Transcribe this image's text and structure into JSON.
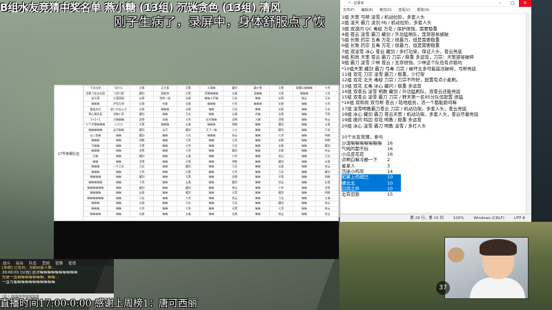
{
  "overlay": {
    "top_text": "B组水友竞猜中奖名单  燕小糖 (13组)  沉迷贪色 (13组)  清风",
    "sub_text": "刚子生病了，录屏中，身体舒服点了恢",
    "ticker": "直播时间17:00-0:00  感谢上周榜1：唐可西丽"
  },
  "sheet": {
    "title": "17号参赛队伍",
    "rows": [
      [
        "下次出发",
        "没什么",
        "天策",
        "无主意",
        "天策",
        "沙漠嘛",
        "藏剑",
        "飘小雪",
        "天策",
        "醉醺么嘛嘛嘛",
        "七秀"
      ],
      [
        "凌霄飞花自在醉",
        "飞凌月影",
        "藏剑",
        "夏乾坤",
        "天策",
        "凌霄嘛嘛嘛",
        "五毒",
        "凌嘛嘛",
        "天策",
        "嘛嘛嘛",
        "七秀"
      ],
      [
        "安乐窝",
        "大漠孤烟",
        "长歌",
        "悠哉一族",
        "长歌",
        "嘛嘛小乔嘛",
        "万花",
        "嘛嘛",
        "长歌",
        "微云",
        "万花"
      ],
      [
        "嘛嘛嘛",
        "护驾左侧",
        "长歌",
        "布鲁",
        "长歌",
        "嘛嘛嘛",
        "七秀",
        "嘛嘛嘛",
        "长歌",
        "嘛嘛",
        "七秀"
      ],
      [
        "霸道夫妇",
        "超人刘长山子",
        "长歌",
        "嘛嘛嘛",
        "长歌",
        "嘛嘛",
        "万花",
        "嘛嘛",
        "长歌",
        "嘛嘛",
        "万花"
      ],
      [
        "寒心赠别某",
        "凌嘛小萌",
        "藏剑",
        "嘛嘛",
        "万花",
        "嘛嘛",
        "五毒",
        "花嘛",
        "长歌",
        "嘛嘛",
        "丐帮"
      ],
      [
        "2+2+1",
        "大嘛嘛嘛",
        "凌雪",
        "朵嘛",
        "七秀",
        "花木嘛嘛",
        "凌雪",
        "大嘛",
        "凌雪",
        "嘛嘛",
        "苍云"
      ],
      [
        "七个步骤嘛嘛嘛",
        "小刀刀",
        "天策",
        "嘛嘛嘛",
        "五毒",
        "嘛嘛嘛",
        "明教",
        "嘛嘛",
        "藏剑",
        "嘛嘛",
        "五毒"
      ],
      [
        "嘛嘛嘛嘛嘛",
        "云可嘛嘛",
        "藏剑",
        "云尽",
        "藏剑",
        "天下一嘛",
        "小刀",
        "嘛嘛",
        "藏剑",
        "嘛嘛",
        "万花"
      ],
      [
        "去二首嘛",
        "嘛嘛",
        "藏剑",
        "嘛嘛",
        "万花",
        "嘛嘛嘛",
        "苍云",
        "嘛嘛",
        "七秀",
        "嘛嘛",
        "明教"
      ],
      [
        "嘛嘛嘛",
        "嘛嘛",
        "明教",
        "嘛嘛",
        "七秀",
        "嘛嘛",
        "七秀",
        "嘛嘛",
        "长歌",
        "嘛嘛",
        "明教"
      ],
      [
        "打嘛嘛",
        "嘛嘛",
        "天策",
        "嘛嘛",
        "七秀",
        "嘛嘛",
        "万花",
        "嘛嘛",
        "长歌",
        "嘛嘛",
        "藏剑"
      ],
      [
        "嘛嘛嘛",
        "嘛嘛",
        "凌雪",
        "嘛嘛",
        "七秀",
        "嘛嘛",
        "藏剑",
        "嘛嘛",
        "长歌",
        "嘛嘛",
        "苍云"
      ],
      [
        "打嘛",
        "嘛嘛",
        "藏剑",
        "嘛嘛",
        "五毒",
        "嘛嘛",
        "七秀",
        "嘛嘛",
        "苍云",
        "嘛嘛",
        "万花"
      ],
      [
        "嘛嘛",
        "嘛嘛",
        "凌雪",
        "嘛嘛",
        "天策",
        "嘛嘛",
        "明教",
        "嘛嘛",
        "藏剑",
        "嘛嘛",
        "长歌"
      ],
      [
        "嘛嘛嘛",
        "一才之玄",
        "万花",
        "嘛嘛",
        "藏剑",
        "嘛嘛",
        "万花",
        "嘛嘛",
        "长歌",
        "嘛嘛",
        "苍云"
      ],
      [
        "嘛嘛嘛",
        "嘛嘛",
        "七秀",
        "嘛嘛",
        "天策",
        "嘛嘛",
        "七秀",
        "嘛嘛",
        "万花",
        "嘛嘛",
        "藏剑"
      ],
      [
        "嘛嘛嘛嘛",
        "嘛嘛",
        "藏剑",
        "嘛嘛",
        "天策",
        "嘛嘛",
        "凌雪",
        "嘛嘛",
        "天策",
        "嘛嘛",
        "明教"
      ],
      [
        "嘛嘛嘛嘛嘛",
        "嘛嘛",
        "七秀",
        "嘛嘛",
        "五毒",
        "嘛嘛",
        "藏剑",
        "嘛嘛",
        "苍云",
        "嘛嘛",
        "长歌"
      ],
      [
        "嘛嘛嘛嘛嘛嘛",
        "嘛嘛",
        "藏剑",
        "嘛嘛",
        "藏剑",
        "嘛嘛",
        "苍云",
        "嘛嘛",
        "七秀",
        "嘛嘛",
        "凌雪"
      ],
      [
        "嘛嘛嘛嘛",
        "嘛嘛",
        "长歌",
        "嘛嘛",
        "藏剑",
        "嘛嘛",
        "天策",
        "嘛嘛",
        "藏剑",
        "嘛嘛",
        "明教"
      ],
      [
        "嘛嘛嘛嘛嘛嘛",
        "嘛嘛",
        "万花",
        "嘛嘛",
        "七秀",
        "嘛嘛",
        "苍云",
        "嘛嘛",
        "万花",
        "嘛嘛",
        "五毒"
      ],
      [
        "嘛嘛嘛",
        "嘛嘛",
        "长歌",
        "嘛嘛",
        "万花",
        "嘛嘛",
        "万花",
        "嘛嘛",
        "藏剑",
        "嘛嘛",
        "苍云"
      ],
      [
        "嘛嘛嘛",
        "嘛嘛",
        "七秀",
        "嘛嘛",
        "七秀",
        "嘛嘛",
        "天策",
        "嘛嘛",
        "七秀",
        "嘛嘛",
        "苍云"
      ],
      [
        "嘛嘛嘛嘛",
        "嘛嘛",
        "长歌",
        "嘛嘛",
        "五毒",
        "嘛嘛",
        "长歌",
        "嘛嘛",
        "苍云",
        "嘛嘛",
        "苍云"
      ]
    ]
  },
  "notepad": {
    "title": "* - 记事本",
    "menu": [
      "文件(F)",
      "编辑(E)",
      "格式(O)",
      "查看(V)",
      "帮助(H)"
    ],
    "close_glyph": "✕",
    "lines": [
      "1组 天策 丐帮 凌雪 / 机动拉阶，多套人头",
      "2组 凌天 霸刀 凌剑 MJ / 机动拉阶，多套人头",
      "3组 双漠问 QC 毒经 万花 / 保护很强，需要稳重",
      "4组 苍云 凌雪 霸刀 藏剑 / 外功猛刷队，莲菜容易被破",
      "5组 长歌 药宗 五毒 万花 / 很暴力，但是需要稳重",
      "6组 长歌 药宗 五毒 万花 / 很暴力，但是需要稳重",
      "7组 双凌雪 冰心 苍云 藏剑 / 多打功架，保证人头，苍云亮底",
      "8组 和尚 天策 苍云 霸刀 刀宗 / 稳重 多运营，刀宗：天策容易破碎",
      "9组 霸刀 凌雪 少林 苍云 / 生存很强，少林这个队伍有点稳坑",
      "*10组天策 藏剑 霸刀 弓毒 刀宗 / 破坏太多可能崩况破碎，弓帮亮底",
      "11组 双花 刀宗 凌雪 霸刀 / 稳重，少打架",
      "12组 双花 北天 毒经 刀宗 / 刀宗不咋好，配置有点小麦刷。",
      "13组 双花 五毒 冰心 藏问 / 稳重 多运营",
      "14组 双苍云 凌雪 明教 藏剑 / 外功猛刷队，双苍云还能亮底",
      "15组 双苍云 凌雪 霸刀 刀宗 / 野天第一名95分队伍配置 很猛",
      "*16组 双和尚 双弓帮 苍云 / 陆地组员，活一个都能跑鸡嘛",
      "17组 凌雪明教霸刀苍云 刀宗 / 机动功架，多套人头，苍云亮底",
      "18组 冰心 藏剑 霸刀 苍云天策 / 机动功架，多套人头，苍云尽量亮底",
      "19组 唐问 鸣囚 双花 明教 / 稳重 多运营",
      "20组 冰心 凌雪 霸刀 明教 凌雪 / 多打人头"
    ],
    "ranking_title": "10个水友竞猜，参与",
    "ranking": [
      {
        "name": "沙漠嘛嘛嘛嘛嘛嘛嘛",
        "score": "16",
        "selected": false
      },
      {
        "name": "气纯的都不玩",
        "score": "16",
        "selected": false
      },
      {
        "name": "小瓜皮花花",
        "score": "16",
        "selected": false
      },
      {
        "name": "点啊白嘛冷静一下",
        "score": "2",
        "selected": false
      },
      {
        "name": "雀某人",
        "score": "3",
        "selected": false
      },
      {
        "name": "沉迷小鸡罕",
        "score": "14",
        "selected": false
      },
      {
        "name": "如果上的胡巳",
        "score": "10",
        "selected": true
      },
      {
        "name": "螺北北",
        "score": "10",
        "selected": true
      },
      {
        "name": "白鸽之声",
        "score": "10",
        "selected": true
      },
      {
        "name": "北有旧狼",
        "score": "15",
        "selected": false
      }
    ],
    "status": {
      "pos": "第 29 行，第 15 列",
      "zoom": "100%",
      "eol": "Windows (CRLF)",
      "enc": "UTF-8"
    }
  },
  "chat": {
    "tabs": [
      "战斗",
      "综合",
      "队伍",
      "其他",
      "密聊",
      "密语"
    ],
    "lines": [
      "[系统] 已签到，当前玩家人数...",
      "20:00:01 [公告] 这次嘛嘛嘛嘛嘛嘛嘛嘛嘛嘛",
      "先是一直嘛嘛嘛嘛嘛嘛嘛，嘛嘛...",
      "一直为着嘛嘛嘛嘛嘛嘛嘛嘛嘛嘛"
    ],
    "input_placeholder": "[输入]嘛嘛嘛嘛嘛嘛嘛嘛"
  },
  "hud": {
    "count": "37"
  }
}
